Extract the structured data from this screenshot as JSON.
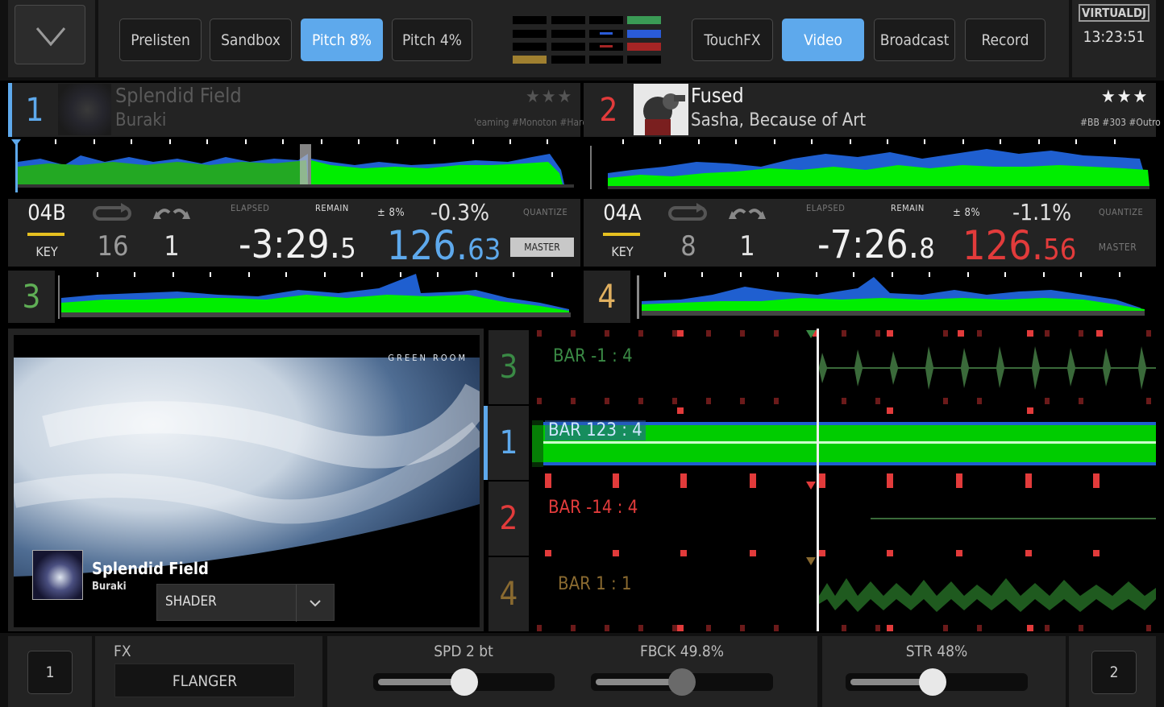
{
  "toolbar": {
    "buttons": [
      {
        "label": "Prelisten",
        "active": false
      },
      {
        "label": "Sandbox",
        "active": false
      },
      {
        "label": "Pitch 8%",
        "active": true
      },
      {
        "label": "Pitch 4%",
        "active": false
      }
    ],
    "right_buttons": [
      {
        "label": "TouchFX",
        "active": false
      },
      {
        "label": "Video",
        "active": true
      },
      {
        "label": "Broadcast",
        "active": false
      },
      {
        "label": "Record",
        "active": false
      }
    ],
    "logo": "VIRTUALDJ",
    "clock": "13:23:51"
  },
  "decks": {
    "deck1": {
      "number": "1",
      "title": "Splendid Field",
      "artist": "Buraki",
      "stars": "★★★",
      "tags": "'eaming #Monoton #Hard",
      "key": "04B",
      "key_label": "KEY",
      "loop": "16",
      "jump": "1",
      "elapsed_label": "ELAPSED",
      "remain_label": "REMAIN",
      "time_main": "-3:29.",
      "time_frac": "5",
      "pitch_range": "± 8%",
      "pitch": "-0.3%",
      "bpm_int": "126.",
      "bpm_frac": "63",
      "quantize_label": "QUANTIZE",
      "master_label": "MASTER",
      "color": "#5ea9ec"
    },
    "deck2": {
      "number": "2",
      "title": "Fused",
      "artist": "Sasha, Because of Art",
      "stars": "★★★",
      "tags": "#BB #303 #Outro",
      "key": "04A",
      "key_label": "KEY",
      "loop": "8",
      "jump": "1",
      "elapsed_label": "ELAPSED",
      "remain_label": "REMAIN",
      "time_main": "-7:26.",
      "time_frac": "8",
      "pitch_range": "± 8%",
      "pitch": "-1.1%",
      "bpm_int": "126.",
      "bpm_frac": "56",
      "quantize_label": "QUANTIZE",
      "master_label": "MASTER",
      "color": "#e23b3b"
    },
    "deck3": {
      "number": "3",
      "color": "#5fae55"
    },
    "deck4": {
      "number": "4",
      "color": "#e0b060"
    }
  },
  "video": {
    "watermark": "GREEN ROOM",
    "title": "Splendid Field",
    "artist": "Buraki",
    "shader_label": "SHADER"
  },
  "rhythm": {
    "rows": [
      {
        "deck": "3",
        "bar": "BAR -1 : 4",
        "color": "#3a8a45"
      },
      {
        "deck": "1",
        "bar": "BAR 123 : 4",
        "color": "#5ea9ec"
      },
      {
        "deck": "2",
        "bar": "BAR -14 : 4",
        "color": "#e23b3b"
      },
      {
        "deck": "4",
        "bar": "BAR 1 : 1",
        "color": "#8a6a30"
      }
    ]
  },
  "fx": {
    "left_deck": "1",
    "right_deck": "2",
    "fx_label": "FX",
    "effect": "FLANGER",
    "params": [
      {
        "label": "SPD 2 bt",
        "level": 0.5
      },
      {
        "label": "FBCK 49.8%",
        "level": 0.5
      },
      {
        "label": "STR 48%",
        "level": 0.48
      }
    ]
  },
  "colors": {
    "accent": "#5ea9ec",
    "deck2": "#e23b3b",
    "wave_green": "#00ee00",
    "wave_blue": "#2a5bd8"
  }
}
